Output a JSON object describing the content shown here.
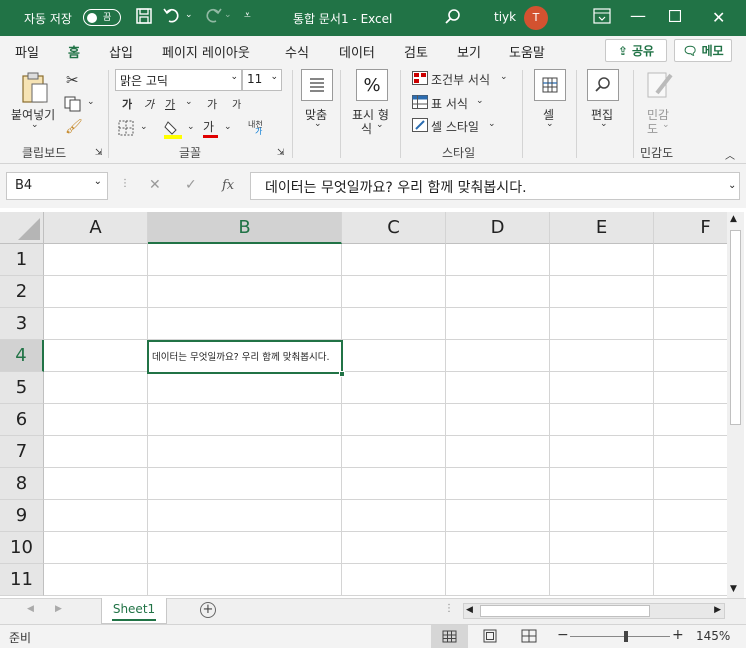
{
  "title_bar": {
    "autosave_label": "자동 저장",
    "autosave_toggle": "끔",
    "document_title": "통합 문서1  -  Excel",
    "user_name": "tiyk",
    "avatar_initial": "T"
  },
  "menu": {
    "tabs": [
      "파일",
      "홈",
      "삽입",
      "페이지 레이아웃",
      "수식",
      "데이터",
      "검토",
      "보기",
      "도움말"
    ],
    "share_label": "공유",
    "comments_label": "메모"
  },
  "ribbon": {
    "clipboard": {
      "paste": "붙여넣기",
      "group": "클립보드"
    },
    "font": {
      "name": "맑은 고딕",
      "size": "11",
      "bold": "가",
      "italic": "가",
      "underline": "가",
      "grow": "가",
      "shrink": "가",
      "phonetic": "내천",
      "color_text": "가",
      "group": "글꼴"
    },
    "alignment": {
      "label": "맞춤"
    },
    "number": {
      "symbol": "%",
      "label_line1": "표시 형",
      "label_line2": "식"
    },
    "styles": {
      "conditional": "조건부 서식",
      "table": "표 서식",
      "cell": "셀 스타일",
      "group": "스타일"
    },
    "cells": {
      "label": "셀"
    },
    "editing": {
      "label": "편집"
    },
    "sensitivity": {
      "label_line1": "민감",
      "label_line2": "도",
      "group": "민감도"
    }
  },
  "formula_bar": {
    "name_box": "B4",
    "fx": "fx",
    "content": "데이터는 무엇일까요? 우리 함께 맞춰봅시다."
  },
  "grid": {
    "columns": [
      "A",
      "B",
      "C",
      "D",
      "E",
      "F"
    ],
    "rows": [
      "1",
      "2",
      "3",
      "4",
      "5",
      "6",
      "7",
      "8",
      "9",
      "10",
      "11"
    ],
    "selected_cell_value": "데이터는 무엇일까요? 우리 함께 맞춰봅시다."
  },
  "sheets": {
    "tabs": [
      "Sheet1"
    ]
  },
  "status_bar": {
    "mode": "준비",
    "zoom": "145%"
  },
  "colors": {
    "accent": "#217346",
    "avatar": "#d35230"
  }
}
